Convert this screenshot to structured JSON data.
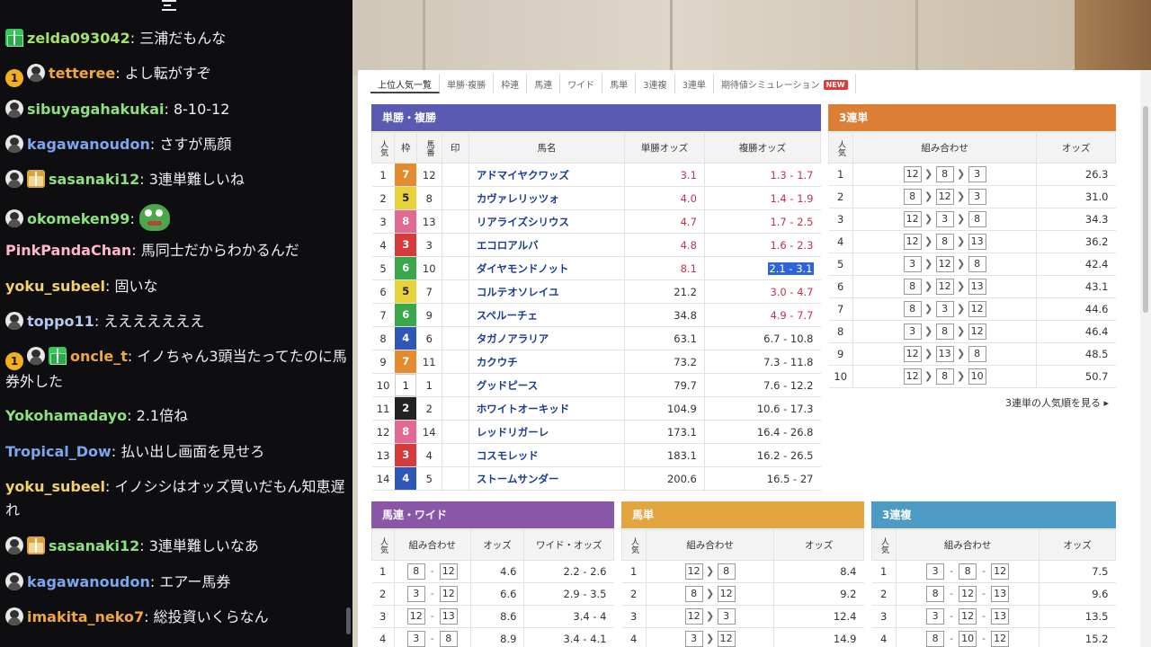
{
  "chat": {
    "messages": [
      {
        "badges": [
          "sub"
        ],
        "name": "zelda093042",
        "color": "#a3e36d",
        "text": "三浦だもんな"
      },
      {
        "badges": [
          "one",
          "horse"
        ],
        "name": "tetteree",
        "color": "#f0a83c",
        "text": "よし転がすぞ"
      },
      {
        "badges": [
          "horse"
        ],
        "name": "sibuyagahakukai",
        "color": "#8ee07f",
        "text": "8-10-12"
      },
      {
        "badges": [
          "horse"
        ],
        "name": "kagawanoudon",
        "color": "#7aa7ef",
        "text": "さすが馬顔"
      },
      {
        "badges": [
          "horse",
          "sub2"
        ],
        "name": "sasanaki12",
        "color": "#8ee07f",
        "text": "3連単難しいね"
      },
      {
        "badges": [
          "horse"
        ],
        "name": "okomeken99",
        "color": "#8ee07f",
        "text": "",
        "emote": "peepo-emote"
      },
      {
        "badges": [],
        "name": "PinkPandaChan",
        "color": "#ffb6cf",
        "text": "馬同士だからわかるんだ"
      },
      {
        "badges": [],
        "name": "yoku_subeel",
        "color": "#f3d06b",
        "text": "固いな"
      },
      {
        "badges": [
          "horse"
        ],
        "name": "toppo11",
        "color": "#b5c8f0",
        "text": "えええええええ"
      },
      {
        "badges": [
          "one",
          "horse",
          "sub"
        ],
        "name": "oncle_t",
        "color": "#f0a83c",
        "text": "イノちゃん3頭当たってたのに馬券外した"
      },
      {
        "badges": [],
        "name": "Yokohamadayo",
        "color": "#8ee07f",
        "text": "2.1倍ね"
      },
      {
        "badges": [],
        "name": "Tropical_Dow",
        "color": "#7aa7ef",
        "text": "払い出し画面を見せろ"
      },
      {
        "badges": [],
        "name": "yoku_subeel",
        "color": "#f3d06b",
        "text": "イノシシはオッズ買いだもん知恵遅れ"
      },
      {
        "badges": [
          "horse",
          "sub2"
        ],
        "name": "sasanaki12",
        "color": "#8ee07f",
        "text": "3連単難しいなあ"
      },
      {
        "badges": [
          "horse"
        ],
        "name": "kagawanoudon",
        "color": "#7aa7ef",
        "text": "エアー馬券"
      },
      {
        "badges": [
          "horse"
        ],
        "name": "imakita_neko7",
        "color": "#f0a83c",
        "text": "総投資いくらなん"
      }
    ]
  },
  "tabs": [
    "上位人気一覧",
    "単勝·複勝",
    "枠連",
    "馬連",
    "ワイド",
    "馬単",
    "3連複",
    "3連単",
    "期待値シミュレーション"
  ],
  "new_badge": "NEW",
  "win_place": {
    "title": "単勝・複勝",
    "headers": [
      "人気",
      "枠",
      "馬番",
      "印",
      "馬名",
      "単勝オッズ",
      "複勝オッズ"
    ],
    "rows": [
      {
        "pop": "1",
        "waku": "7",
        "num": "12",
        "name": "アドマイヤクワッズ",
        "win": "3.1",
        "place": "1.3 - 1.7"
      },
      {
        "pop": "2",
        "waku": "5",
        "num": "8",
        "name": "カヴァレリッツォ",
        "win": "4.0",
        "place": "1.4 - 1.9"
      },
      {
        "pop": "3",
        "waku": "8",
        "num": "13",
        "name": "リアライズシリウス",
        "win": "4.7",
        "place": "1.7 - 2.5"
      },
      {
        "pop": "4",
        "waku": "3",
        "num": "3",
        "name": "エコロアルバ",
        "win": "4.8",
        "place": "1.6 - 2.3"
      },
      {
        "pop": "5",
        "waku": "6",
        "num": "10",
        "name": "ダイヤモンドノット",
        "win": "8.1",
        "place": "2.1 - 3.1"
      },
      {
        "pop": "6",
        "waku": "5",
        "num": "7",
        "name": "コルテオソレイユ",
        "win": "21.2",
        "place": "3.0 - 4.7"
      },
      {
        "pop": "7",
        "waku": "6",
        "num": "9",
        "name": "スペルーチェ",
        "win": "34.8",
        "place": "4.9 - 7.7"
      },
      {
        "pop": "8",
        "waku": "4",
        "num": "6",
        "name": "タガノアラリア",
        "win": "63.1",
        "place": "6.7 - 10.8"
      },
      {
        "pop": "9",
        "waku": "7",
        "num": "11",
        "name": "カクウチ",
        "win": "73.2",
        "place": "7.3 - 11.8"
      },
      {
        "pop": "10",
        "waku": "1",
        "num": "1",
        "name": "グッドピース",
        "win": "79.7",
        "place": "7.6 - 12.2"
      },
      {
        "pop": "11",
        "waku": "2",
        "num": "2",
        "name": "ホワイトオーキッド",
        "win": "104.9",
        "place": "10.6 - 17.3"
      },
      {
        "pop": "12",
        "waku": "8",
        "num": "14",
        "name": "レッドリガーレ",
        "win": "173.1",
        "place": "16.4 - 26.8"
      },
      {
        "pop": "13",
        "waku": "3",
        "num": "4",
        "name": "コスモレッド",
        "win": "183.1",
        "place": "16.2 - 26.5"
      },
      {
        "pop": "14",
        "waku": "4",
        "num": "5",
        "name": "ストームサンダー",
        "win": "200.6",
        "place": "16.5 - 27"
      }
    ]
  },
  "waku_colors": {
    "1": "#ffffff",
    "2": "#222222",
    "3": "#d63a3a",
    "4": "#2f57b8",
    "5": "#e9d33c",
    "6": "#3aa84a",
    "7": "#e58b2e",
    "8": "#e06a93"
  },
  "trifecta": {
    "title": "3連単",
    "headers": [
      "人気",
      "組み合わせ",
      "オッズ"
    ],
    "rows": [
      {
        "pop": "1",
        "combo": [
          "12",
          "8",
          "3"
        ],
        "odds": "26.3"
      },
      {
        "pop": "2",
        "combo": [
          "8",
          "12",
          "3"
        ],
        "odds": "31.0"
      },
      {
        "pop": "3",
        "combo": [
          "12",
          "3",
          "8"
        ],
        "odds": "34.3"
      },
      {
        "pop": "4",
        "combo": [
          "12",
          "8",
          "13"
        ],
        "odds": "36.2"
      },
      {
        "pop": "5",
        "combo": [
          "3",
          "12",
          "8"
        ],
        "odds": "42.4"
      },
      {
        "pop": "6",
        "combo": [
          "8",
          "12",
          "13"
        ],
        "odds": "43.1"
      },
      {
        "pop": "7",
        "combo": [
          "8",
          "3",
          "12"
        ],
        "odds": "44.6"
      },
      {
        "pop": "8",
        "combo": [
          "3",
          "8",
          "12"
        ],
        "odds": "46.4"
      },
      {
        "pop": "9",
        "combo": [
          "12",
          "13",
          "8"
        ],
        "odds": "48.5"
      },
      {
        "pop": "10",
        "combo": [
          "12",
          "8",
          "10"
        ],
        "odds": "50.7"
      }
    ],
    "more_link": "3連単の人気順を見る ▸"
  },
  "quinella": {
    "title": "馬連・ワイド",
    "headers": [
      "人気",
      "組み合わせ",
      "オッズ",
      "ワイド・オッズ"
    ],
    "rows": [
      {
        "pop": "1",
        "combo": [
          "8",
          "12"
        ],
        "odds": "4.6",
        "wide": "2.2 - 2.6"
      },
      {
        "pop": "2",
        "combo": [
          "3",
          "12"
        ],
        "odds": "6.6",
        "wide": "2.9 - 3.5"
      },
      {
        "pop": "3",
        "combo": [
          "12",
          "13"
        ],
        "odds": "8.6",
        "wide": "3.4 - 4"
      },
      {
        "pop": "4",
        "combo": [
          "3",
          "8"
        ],
        "odds": "8.9",
        "wide": "3.4 - 4.1"
      }
    ]
  },
  "exacta": {
    "title": "馬単",
    "headers": [
      "人気",
      "組み合わせ",
      "オッズ"
    ],
    "rows": [
      {
        "pop": "1",
        "combo": [
          "12",
          "8"
        ],
        "odds": "8.4"
      },
      {
        "pop": "2",
        "combo": [
          "8",
          "12"
        ],
        "odds": "9.2"
      },
      {
        "pop": "3",
        "combo": [
          "12",
          "3"
        ],
        "odds": "12.4"
      },
      {
        "pop": "4",
        "combo": [
          "3",
          "12"
        ],
        "odds": "14.9"
      }
    ]
  },
  "trio": {
    "title": "3連複",
    "headers": [
      "人気",
      "組み合わせ",
      "オッズ"
    ],
    "rows": [
      {
        "pop": "1",
        "combo": [
          "3",
          "8",
          "12"
        ],
        "odds": "7.5"
      },
      {
        "pop": "2",
        "combo": [
          "8",
          "12",
          "13"
        ],
        "odds": "9.6"
      },
      {
        "pop": "3",
        "combo": [
          "3",
          "12",
          "13"
        ],
        "odds": "13.5"
      },
      {
        "pop": "4",
        "combo": [
          "8",
          "10",
          "12"
        ],
        "odds": "15.2"
      }
    ]
  },
  "colors": {
    "win_place": "#5a5ab3",
    "trifecta": "#dd7e35",
    "quinella": "#8a56a8",
    "exacta": "#e2a53f",
    "trio": "#4d9bc4"
  }
}
